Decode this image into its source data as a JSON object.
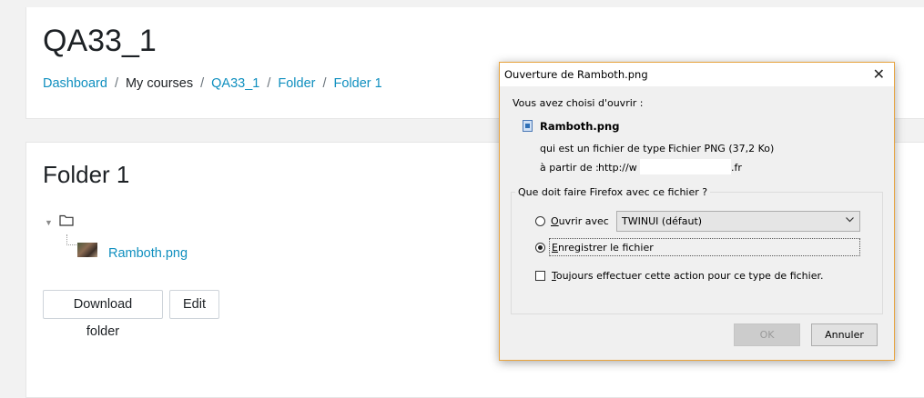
{
  "header": {
    "title": "QA33_1",
    "breadcrumb": [
      "Dashboard",
      "My courses",
      "QA33_1",
      "Folder",
      "Folder 1"
    ]
  },
  "main": {
    "title": "Folder 1",
    "tree": {
      "toggle_icon": "▼",
      "file": "Ramboth.png"
    },
    "buttons": {
      "download": "Download folder",
      "edit": "Edit"
    }
  },
  "dialog": {
    "title": "Ouverture de Ramboth.png",
    "close_glyph": "✕",
    "intro": "Vous avez choisi d'ouvrir :",
    "filename": "Ramboth.png",
    "type_label": "qui est un fichier de type :",
    "type_value": "Fichier PNG (37,2 Ko)",
    "from_label": "à partir de :",
    "from_prefix": "http://w",
    "from_suffix": ".fr",
    "question": "Que doit faire Firefox avec ce fichier ?",
    "open_with_first": "O",
    "open_with_rest": "uvrir avec",
    "open_with_app": "TWINUI (défaut)",
    "save_first": "E",
    "save_rest": "nregistrer le fichier",
    "always_first": "T",
    "always_rest": "oujours effectuer cette action pour ce type de fichier.",
    "ok": "OK",
    "cancel": "Annuler",
    "selected_option": "save",
    "always_checked": false
  },
  "colors": {
    "link": "#0f8fbf",
    "dialog_border": "#e8a33d"
  }
}
